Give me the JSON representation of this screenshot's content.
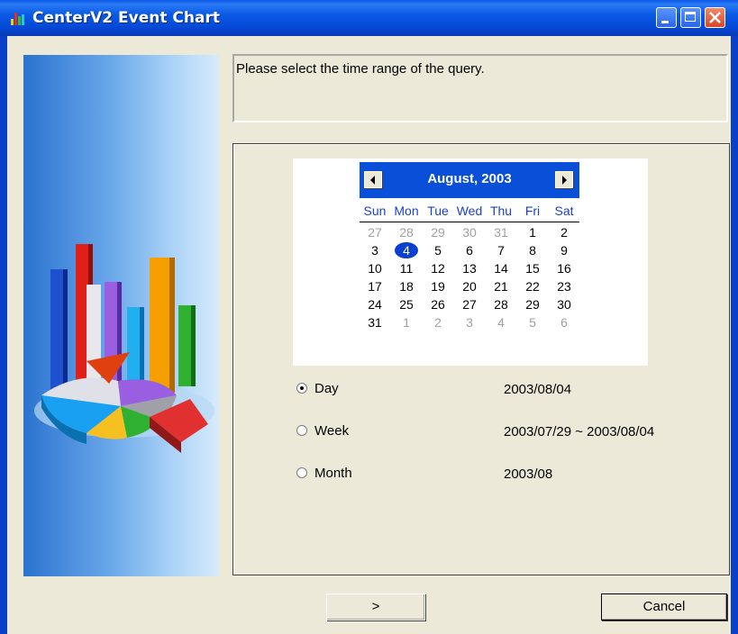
{
  "window": {
    "title": "CenterV2 Event Chart",
    "icon": "bar-chart-icon"
  },
  "prompt": {
    "text": "Please select the time range of the query."
  },
  "calendar": {
    "month_label": "August, 2003",
    "weekdays": [
      "Sun",
      "Mon",
      "Tue",
      "Wed",
      "Thu",
      "Fri",
      "Sat"
    ],
    "weeks": [
      [
        "27",
        "28",
        "29",
        "30",
        "31",
        "1",
        "2"
      ],
      [
        "3",
        "4",
        "5",
        "6",
        "7",
        "8",
        "9"
      ],
      [
        "10",
        "11",
        "12",
        "13",
        "14",
        "15",
        "16"
      ],
      [
        "17",
        "18",
        "19",
        "20",
        "21",
        "22",
        "23"
      ],
      [
        "24",
        "25",
        "26",
        "27",
        "28",
        "29",
        "30"
      ],
      [
        "31",
        "1",
        "2",
        "3",
        "4",
        "5",
        "6"
      ]
    ],
    "selected_day": "4"
  },
  "options": [
    {
      "label": "Day",
      "value": "2003/08/04",
      "selected": true
    },
    {
      "label": "Week",
      "value": "2003/07/29 ~ 2003/08/04",
      "selected": false
    },
    {
      "label": "Month",
      "value": "2003/08",
      "selected": false
    }
  ],
  "buttons": {
    "next_label": ">",
    "cancel_label": "Cancel"
  },
  "colors": {
    "title_bar": "#0a58e8",
    "calendar_header": "#0a4fd8",
    "selection": "#0a3fd0"
  }
}
